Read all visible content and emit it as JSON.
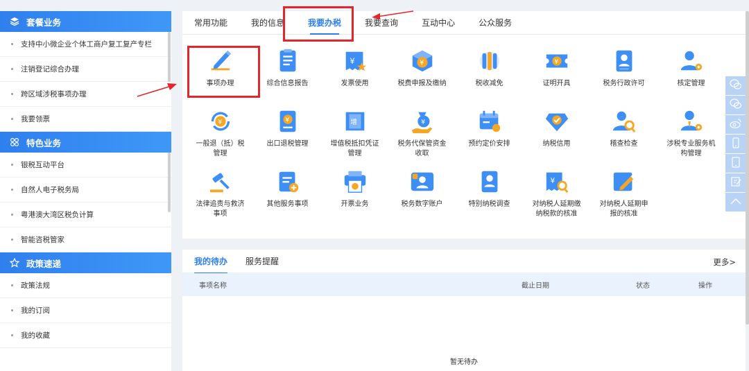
{
  "sidebar": {
    "sections": [
      {
        "title": "套餐业务",
        "icon": "layers-icon",
        "items": [
          "支持中小微企业个体工商户复工复产专栏",
          "注销登记综合办理",
          "跨区域涉税事项办理",
          "我要领票"
        ]
      },
      {
        "title": "特色业务",
        "icon": "grid-icon",
        "items": [
          "银税互动平台",
          "自然人电子税务局",
          "粤港澳大湾区税负计算",
          "智能咨税管家"
        ]
      },
      {
        "title": "政策速递",
        "icon": "star-icon",
        "items": [
          "政策法规",
          "我的订阅",
          "我的收藏"
        ]
      }
    ]
  },
  "top_tabs": [
    "常用功能",
    "我的信息",
    "我要办税",
    "我要查询",
    "互动中心",
    "公众服务"
  ],
  "active_tab": "我要办税",
  "tiles": [
    {
      "label": "事项办理",
      "icon": "pencil-icon"
    },
    {
      "label": "综合信息报告",
      "icon": "document-icon"
    },
    {
      "label": "发票使用",
      "icon": "invoice-icon"
    },
    {
      "label": "税费申报及缴纳",
      "icon": "box-yuan-icon"
    },
    {
      "label": "税收减免",
      "icon": "coins-icon"
    },
    {
      "label": "证明开具",
      "icon": "ticket-yuan-icon"
    },
    {
      "label": "税务行政许可",
      "icon": "id-card-icon"
    },
    {
      "label": "核定管理",
      "icon": "user-gear-icon"
    },
    {
      "label": "一般退（抵）税\n管理",
      "icon": "refund-icon"
    },
    {
      "label": "出口退税管理",
      "icon": "yuan-card-icon"
    },
    {
      "label": "增值税抵扣凭证\n管理",
      "icon": "vat-ticket-icon"
    },
    {
      "label": "税务代保管资金\n收取",
      "icon": "money-bag-icon"
    },
    {
      "label": "预约定价安排",
      "icon": "calendar-icon"
    },
    {
      "label": "纳税信用",
      "icon": "diamond-check-icon"
    },
    {
      "label": "稽查检查",
      "icon": "user-search-icon"
    },
    {
      "label": "涉税专业服务机\n构管理",
      "icon": "agent-gear-icon"
    },
    {
      "label": "法律追责与救济\n事项",
      "icon": "gavel-icon"
    },
    {
      "label": "其他服务事项",
      "icon": "clipboard-plus-icon"
    },
    {
      "label": "开票业务",
      "icon": "printer-icon"
    },
    {
      "label": "税务数字账户",
      "icon": "digital-account-icon"
    },
    {
      "label": "特别纳税调查",
      "icon": "person-doc-icon"
    },
    {
      "label": "对纳税人延期缴\n纳税款的核准",
      "icon": "yuan-search-icon"
    },
    {
      "label": "对纳税人延期申\n报的核准",
      "icon": "edit-card-icon"
    }
  ],
  "todo": {
    "tabs": [
      "我的待办",
      "服务提醒"
    ],
    "more": "更多>",
    "columns": [
      "事项名称",
      "截止日期",
      "状态",
      "操作"
    ],
    "empty": "暂无待办"
  },
  "float_toolbar": [
    "wechat-icon",
    "wechat-icon",
    "weibo-icon",
    "mobile-icon",
    "tablet-icon",
    "edit-icon",
    "back-to-top-icon"
  ],
  "colors": {
    "accent": "#2d7ff0",
    "annotation": "#e3262b",
    "header": "#3f98f7"
  }
}
